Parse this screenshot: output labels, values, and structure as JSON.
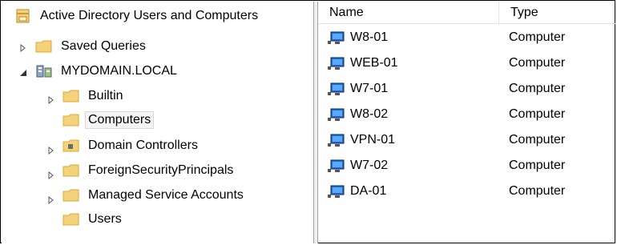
{
  "tree": {
    "root_label": "Active Directory Users and Computers",
    "saved_queries": "Saved Queries",
    "domain": "MYDOMAIN.LOCAL",
    "children": [
      {
        "label": "Builtin",
        "expander": true,
        "selected": false
      },
      {
        "label": "Computers",
        "expander": false,
        "selected": true
      },
      {
        "label": "Domain Controllers",
        "expander": true,
        "selected": false
      },
      {
        "label": "ForeignSecurityPrincipals",
        "expander": true,
        "selected": false
      },
      {
        "label": "Managed Service Accounts",
        "expander": true,
        "selected": false
      },
      {
        "label": "Users",
        "expander": false,
        "selected": false
      }
    ]
  },
  "list": {
    "columns": [
      "Name",
      "Type"
    ],
    "rows": [
      {
        "name": "W8-01",
        "type": "Computer"
      },
      {
        "name": "WEB-01",
        "type": "Computer"
      },
      {
        "name": "W7-01",
        "type": "Computer"
      },
      {
        "name": "W8-02",
        "type": "Computer"
      },
      {
        "name": "VPN-01",
        "type": "Computer"
      },
      {
        "name": "W7-02",
        "type": "Computer"
      },
      {
        "name": "DA-01",
        "type": "Computer"
      }
    ]
  },
  "colors": {
    "folder": "#f4d27a",
    "folder_dark": "#d9a93a",
    "monitor": "#1e6fd9",
    "selection_bg": "#f5f5f5"
  }
}
